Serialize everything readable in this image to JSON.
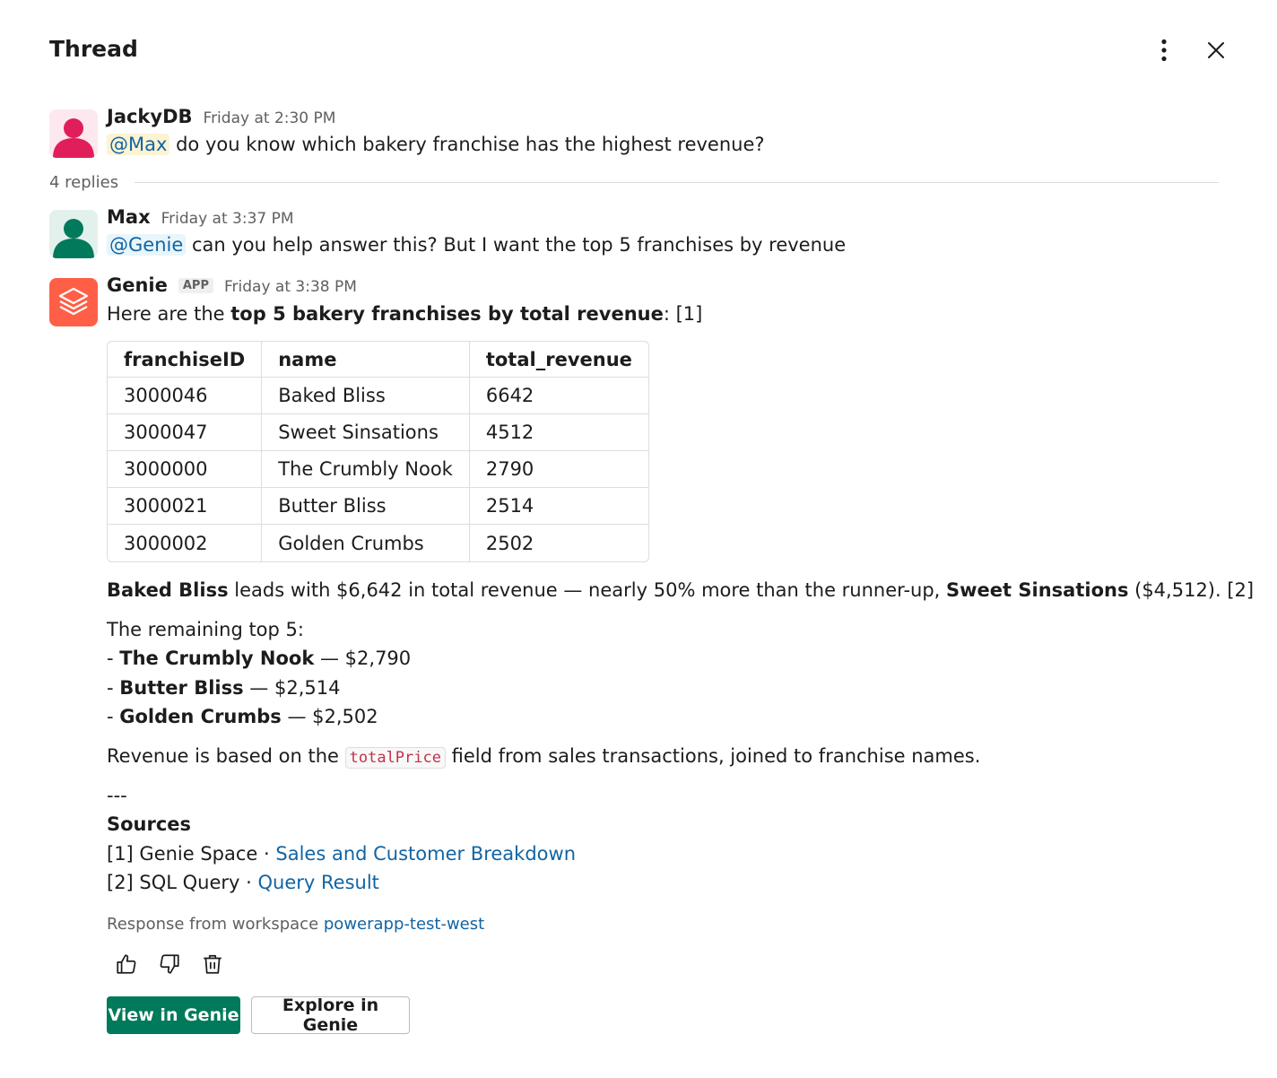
{
  "header": {
    "title": "Thread"
  },
  "colors": {
    "mention_text": "#1264a3",
    "primary_button": "#007a5a",
    "avatar_jacky": "#e01e5a",
    "avatar_max": "#007a5a",
    "avatar_genie": "#ff5f46"
  },
  "parent_message": {
    "author": "JackyDB",
    "time": "Friday at 2:30 PM",
    "mention": "@Max",
    "text": " do you know which bakery franchise has the highest revenue?"
  },
  "replies": {
    "label": "4 replies"
  },
  "max_message": {
    "author": "Max",
    "time": "Friday at 3:37 PM",
    "mention": "@Genie",
    "text": " can you help answer this? But I want the top 5 franchises by revenue"
  },
  "genie_message": {
    "author": "Genie",
    "badge": "APP",
    "time": "Friday at 3:38 PM",
    "intro_prefix": "Here are the ",
    "intro_bold": "top 5 bakery franchises by total revenue",
    "intro_suffix": ": [1]",
    "table": {
      "headers": [
        "franchiseID",
        "name",
        "total_revenue"
      ],
      "rows": [
        [
          "3000046",
          "Baked Bliss",
          "6642"
        ],
        [
          "3000047",
          "Sweet Sinsations",
          "4512"
        ],
        [
          "3000000",
          "The Crumbly Nook",
          "2790"
        ],
        [
          "3000021",
          "Butter Bliss",
          "2514"
        ],
        [
          "3000002",
          "Golden Crumbs",
          "2502"
        ]
      ]
    },
    "summary": {
      "lead_bold": "Baked Bliss",
      "lead_mid": " leads with $6,642 in total revenue — nearly 50% more than the runner-up, ",
      "runner_bold": "Sweet Sinsations",
      "runner_suffix": " ($4,512). [2]"
    },
    "remaining": {
      "title": "The remaining top 5:",
      "items": [
        {
          "prefix": "- ",
          "name": "The Crumbly Nook",
          "value": " — $2,790"
        },
        {
          "prefix": "- ",
          "name": "Butter Bliss",
          "value": " — $2,514"
        },
        {
          "prefix": "- ",
          "name": "Golden Crumbs",
          "value": " — $2,502"
        }
      ]
    },
    "basis": {
      "prefix": "Revenue is based on the ",
      "code": "totalPrice",
      "suffix": " field from sales transactions, joined to franchise names."
    },
    "separator": "---",
    "sources": {
      "title": "Sources",
      "items": [
        {
          "prefix": "[1] Genie Space · ",
          "link": "Sales and Customer Breakdown"
        },
        {
          "prefix": "[2] SQL Query · ",
          "link": "Query Result"
        }
      ]
    },
    "workspace": {
      "prefix": "Response from workspace ",
      "link": "powerapp-test-west"
    },
    "buttons": {
      "view": "View in Genie",
      "explore": "Explore in Genie"
    }
  }
}
